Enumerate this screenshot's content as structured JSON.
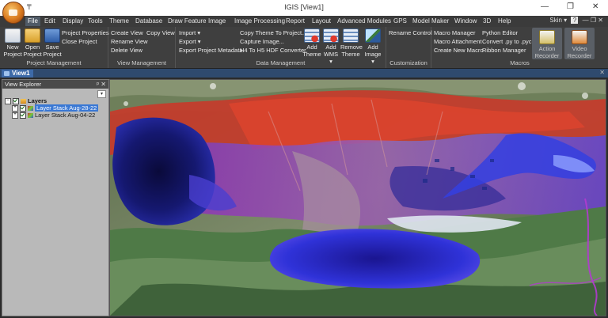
{
  "app": {
    "title": "IGIS [View1]",
    "quick_access": "₸",
    "window_controls": {
      "minimize": "—",
      "restore": "❐",
      "close": "✕"
    }
  },
  "menu": {
    "items": [
      "File",
      "Edit",
      "Display",
      "Tools",
      "Theme",
      "Database",
      "Draw Feature",
      "Image",
      "Image Processing",
      "Report",
      "Layout",
      "Advanced Modules",
      "GPS",
      "Model Maker",
      "Window",
      "3D",
      "Help"
    ],
    "active": "File",
    "skin_label": "Skin ▾",
    "help_icon": "?",
    "right_controls": "— ❐ ✕"
  },
  "ribbon": {
    "project_management": {
      "label": "Project Management",
      "new_label": "New Project",
      "open_label": "Open Project",
      "save_label": "Save Project",
      "properties_label": "Project Properties",
      "close_label": "Close Project"
    },
    "view_management": {
      "label": "View Management",
      "create_view": "Create View",
      "copy_view": "Copy View",
      "rename_view": "Rename View",
      "delete_view": "Delete View"
    },
    "data_management": {
      "label": "Data Management",
      "import": "Import ▾",
      "export": "Export ▾",
      "export_metadata": "Export Project Metadata",
      "copy_theme": "Copy Theme To Project...",
      "capture_image": "Capture Image...",
      "hdf_converter": "H4 To H5 HDF Converter",
      "add_theme": "Add Theme",
      "add_wms": "Add WMS ▾",
      "remove_theme": "Remove Theme",
      "add_image": "Add Image ▾"
    },
    "customization": {
      "label": "Customization",
      "rename_control": "Rename Control"
    },
    "macros": {
      "label": "Macros",
      "macro_manager": "Macro Manager",
      "macro_attachment": "Macro Attachment",
      "create_new_macro": "Create New Macro",
      "python_editor": "Python Editor",
      "convert_py": "Convert .py to .pyc",
      "ribbon_manager": "Ribbon Manager",
      "action_recorder": "Action Recorder",
      "video_recorder": "Video Recorder"
    }
  },
  "view_tab": {
    "label": "View1",
    "close": "✕"
  },
  "explorer": {
    "title": "View Explorer",
    "pin": "ᵖ",
    "close": "✕",
    "dropdown": "▾",
    "root_label": "Layers",
    "layers": [
      "Layer Stack Aug-28-22",
      "Layer Stack Aug-04-22"
    ],
    "selected_index": 0
  }
}
